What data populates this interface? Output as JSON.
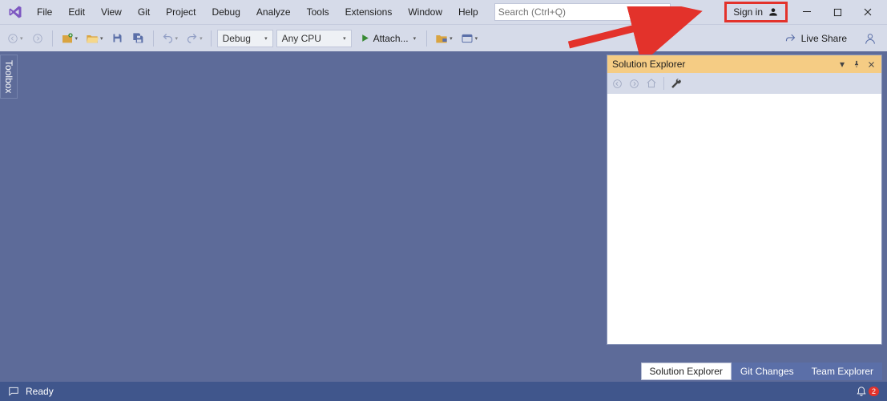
{
  "menubar": {
    "items": [
      "File",
      "Edit",
      "View",
      "Git",
      "Project",
      "Debug",
      "Analyze",
      "Tools",
      "Extensions",
      "Window",
      "Help"
    ],
    "search_placeholder": "Search (Ctrl+Q)",
    "signin_label": "Sign in"
  },
  "toolbar": {
    "config_combo": "Debug",
    "platform_combo": "Any CPU",
    "attach_label": "Attach...",
    "liveshare_label": "Live Share"
  },
  "sidebar": {
    "toolbox_label": "Toolbox"
  },
  "solution_explorer": {
    "title": "Solution Explorer"
  },
  "bottom_tabs": {
    "tab0": "Solution Explorer",
    "tab1": "Git Changes",
    "tab2": "Team Explorer"
  },
  "statusbar": {
    "ready": "Ready",
    "notif_count": "2"
  },
  "annotation": {
    "color": "#e3322b"
  }
}
